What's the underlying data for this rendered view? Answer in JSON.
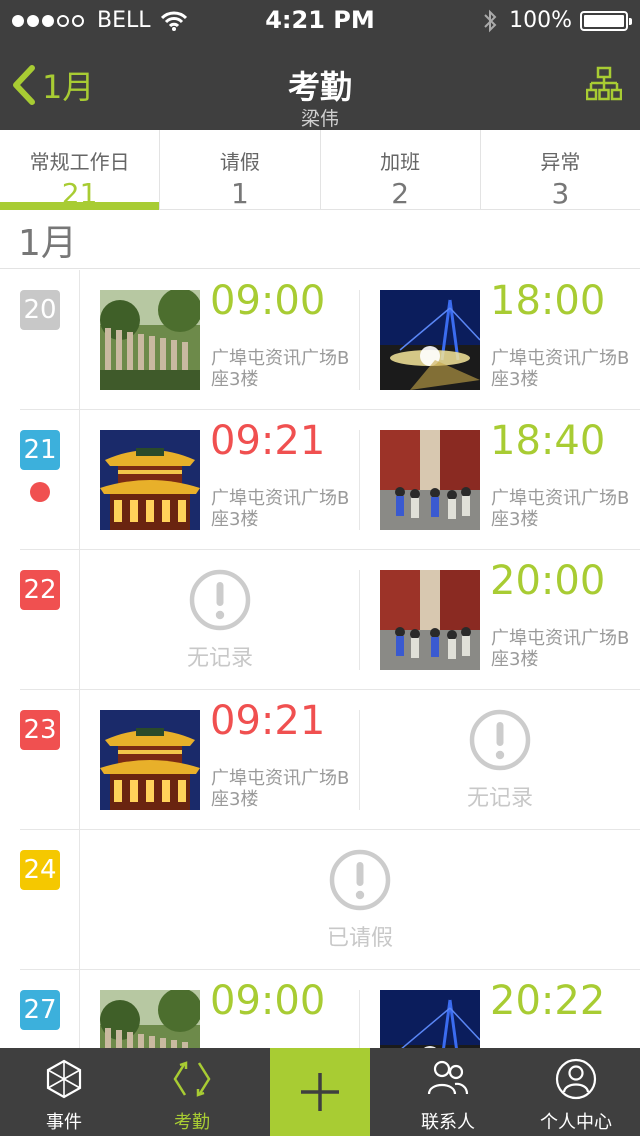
{
  "status_bar": {
    "carrier": "BELL",
    "time": "4:21 PM",
    "battery": "100%"
  },
  "nav": {
    "back_label": "1月",
    "title": "考勤",
    "subtitle": "梁伟"
  },
  "summary_tabs": [
    {
      "label": "常规工作日",
      "count": "21",
      "active": true
    },
    {
      "label": "请假",
      "count": "1",
      "active": false
    },
    {
      "label": "加班",
      "count": "2",
      "active": false
    },
    {
      "label": "异常",
      "count": "3",
      "active": false
    }
  ],
  "month_header": "1月",
  "days": [
    {
      "day": "20",
      "badge_color": "#c8c8c8",
      "abnormal_dot": false,
      "am": {
        "time": "09:00",
        "late": false,
        "location": "广埠屯资讯广场B座3楼",
        "photo": "fence"
      },
      "pm": {
        "time": "18:00",
        "late": false,
        "location": "广埠屯资讯广场B座3楼",
        "photo": "bridge"
      }
    },
    {
      "day": "21",
      "badge_color": "#3cb0dc",
      "abnormal_dot": true,
      "am": {
        "time": "09:21",
        "late": true,
        "location": "广埠屯资讯广场B座3楼",
        "photo": "temple"
      },
      "pm": {
        "time": "18:40",
        "late": false,
        "location": "广埠屯资讯广场B座3楼",
        "photo": "street"
      }
    },
    {
      "day": "22",
      "badge_color": "#f05050",
      "abnormal_dot": false,
      "am": {
        "none": true,
        "label": "无记录"
      },
      "pm": {
        "time": "20:00",
        "late": false,
        "location": "广埠屯资讯广场B座3楼",
        "photo": "street"
      }
    },
    {
      "day": "23",
      "badge_color": "#f05050",
      "abnormal_dot": false,
      "am": {
        "time": "09:21",
        "late": true,
        "location": "广埠屯资讯广场B座3楼",
        "photo": "temple"
      },
      "pm": {
        "none": true,
        "label": "无记录"
      }
    },
    {
      "day": "24",
      "badge_color": "#f5c800",
      "abnormal_dot": false,
      "full_day": {
        "label": "已请假"
      }
    },
    {
      "day": "27",
      "badge_color": "#3cb0dc",
      "abnormal_dot": false,
      "am": {
        "time": "09:00",
        "late": false,
        "location": "",
        "photo": "fence"
      },
      "pm": {
        "time": "20:22",
        "late": false,
        "location": "",
        "photo": "bridge"
      }
    }
  ],
  "tab_bar": [
    {
      "label": "事件",
      "icon": "cube-icon",
      "active": false
    },
    {
      "label": "考勤",
      "icon": "sync-arrows-icon",
      "active": true
    },
    {
      "label": "",
      "icon": "plus-icon",
      "active": false
    },
    {
      "label": "联系人",
      "icon": "contacts-icon",
      "active": false
    },
    {
      "label": "个人中心",
      "icon": "profile-icon",
      "active": false
    }
  ],
  "colors": {
    "accent": "#a8cc33",
    "late": "#f05050",
    "dark_bar": "#3f3f3f"
  }
}
